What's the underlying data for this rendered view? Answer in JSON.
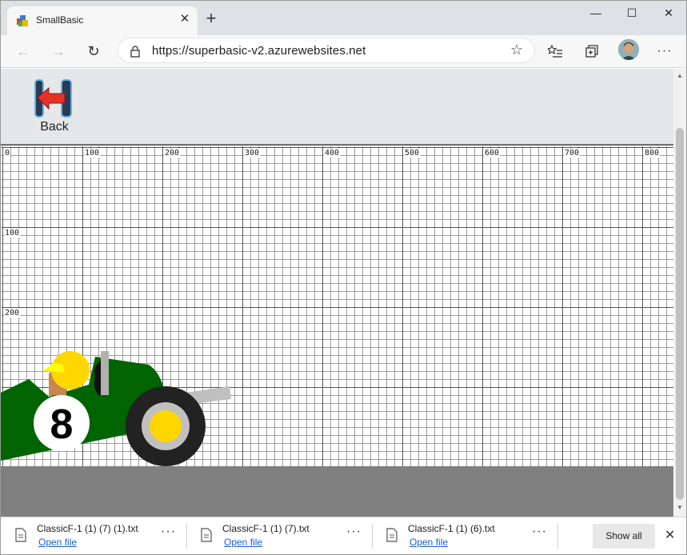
{
  "browser": {
    "tab_title": "SmallBasic",
    "tab_close": "✕",
    "new_tab": "+",
    "url": "https://superbasic-v2.azurewebsites.net",
    "minimize": "—",
    "maximize": "☐",
    "close": "✕",
    "back": "←",
    "forward": "→",
    "refresh": "↻",
    "favorite": "☆",
    "more": "···"
  },
  "app": {
    "back_label": "Back",
    "x_ticks": [
      "0",
      "100",
      "200",
      "300",
      "400",
      "500",
      "600",
      "700",
      "800"
    ],
    "y_ticks": [
      "100",
      "200"
    ],
    "car_number": "8",
    "colors": {
      "car_body": "#006400",
      "helmet": "#ffd700",
      "visor": "#ffff00",
      "wheel": "#222222",
      "hub": "#ffd700",
      "ground": "#808080"
    }
  },
  "downloads": {
    "items": [
      {
        "name": "ClassicF-1 (1) (7) (1).txt",
        "action": "Open file"
      },
      {
        "name": "ClassicF-1 (1) (7).txt",
        "action": "Open file"
      },
      {
        "name": "ClassicF-1 (1) (6).txt",
        "action": "Open file"
      }
    ],
    "more": "···",
    "show_all": "Show all",
    "close": "✕"
  }
}
